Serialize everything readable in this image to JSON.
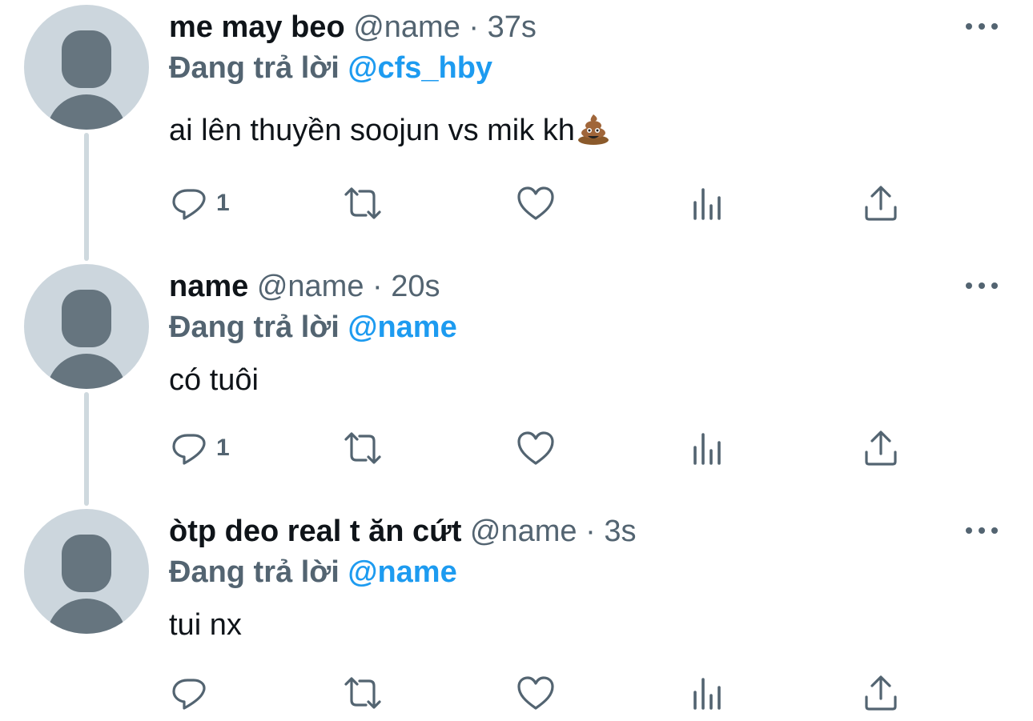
{
  "reply_prefix": "Đang trả lời",
  "tweets": [
    {
      "display_name": "me may beo",
      "handle": "@name",
      "separator": "·",
      "time": "37s",
      "reply_to": "@cfs_hby",
      "text": "ai lên thuyền soojun vs mik kh",
      "emoji": "pile-of-poo-emoji",
      "reply_count": "1"
    },
    {
      "display_name": "name",
      "handle": "@name",
      "separator": "·",
      "time": "20s",
      "reply_to": "@name",
      "text": "có tuôi",
      "reply_count": "1"
    },
    {
      "display_name": "òtp deo real t ăn cứt",
      "handle": "@name",
      "separator": "·",
      "time": "3s",
      "reply_to": "@name",
      "text": "tui nx",
      "reply_count": ""
    }
  ],
  "icons": {
    "reply": "reply-icon",
    "retweet": "retweet-icon",
    "like": "like-icon",
    "views": "views-icon",
    "share": "share-icon",
    "more": "more-icon"
  },
  "colors": {
    "text_primary": "#0f1419",
    "text_secondary": "#536471",
    "mention": "#1d9bf0",
    "avatar_bg": "#ccd6dd",
    "avatar_fg": "#66757f",
    "thread_line": "#cfd9de"
  }
}
